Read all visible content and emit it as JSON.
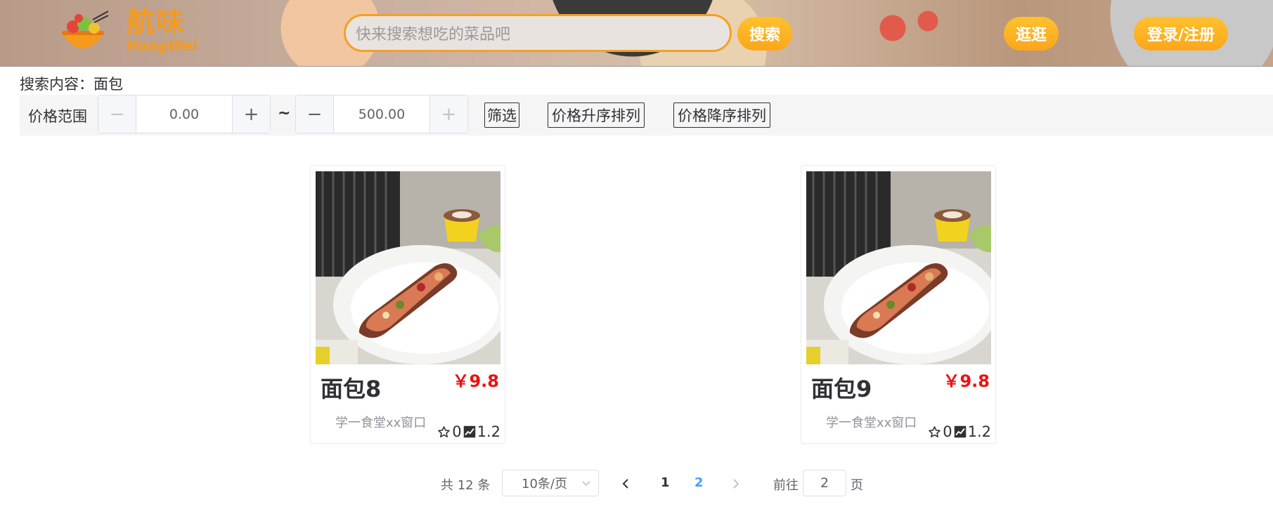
{
  "header": {
    "logo_cn": "航味",
    "logo_en": "HangWei",
    "search_placeholder": "快来搜索想吃的菜品吧",
    "search_button": "搜索",
    "browse_button": "逛逛",
    "login_button": "登录/注册"
  },
  "search_result": {
    "label": "搜索内容：面包"
  },
  "filter": {
    "label": "价格范围",
    "min_value": "0.00",
    "max_value": "500.00",
    "minus_symbol": "−",
    "plus_symbol": "+",
    "tilde": "~",
    "filter_button": "筛选",
    "sort_asc_button": "价格升序排列",
    "sort_desc_button": "价格降序排列"
  },
  "items": [
    {
      "name": "面包8",
      "price": "￥9.8",
      "shop": "学一食堂xx窗口",
      "stars": "0",
      "trend": "1.2"
    },
    {
      "name": "面包9",
      "price": "￥9.8",
      "shop": "学一食堂xx窗口",
      "stars": "0",
      "trend": "1.2"
    }
  ],
  "pagination": {
    "total": "共 12 条",
    "page_size": "10条/页",
    "pages": [
      "1",
      "2"
    ],
    "current_page": "2",
    "goto_label": "前往",
    "goto_value": "2",
    "page_label": "页"
  },
  "colors": {
    "accent": "#f5a023",
    "price": "#ee1111",
    "active_page": "#409eff"
  }
}
